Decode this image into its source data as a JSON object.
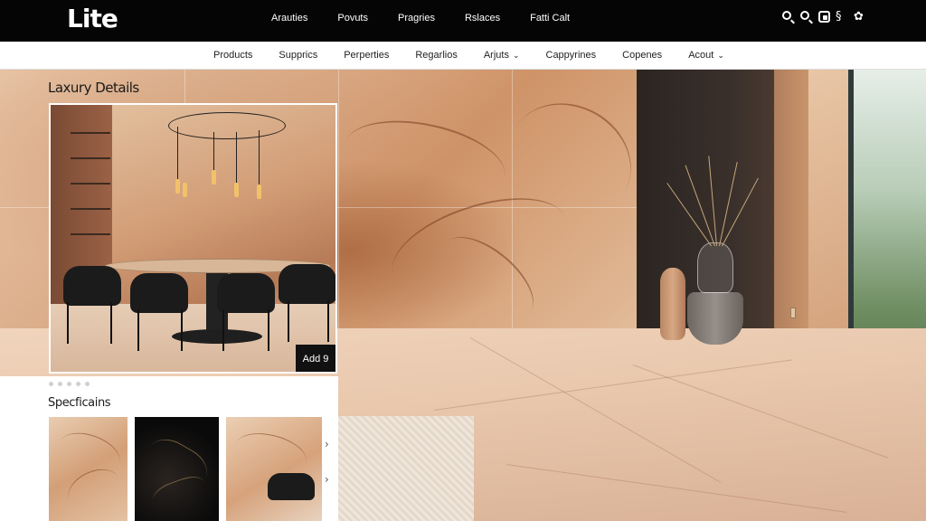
{
  "brand": {
    "logo": "Lite"
  },
  "top_nav": [
    "Arauties",
    "Povuts",
    "Pragries",
    "Rslaces",
    "Fatti Calt"
  ],
  "top_icons": [
    "search-icon",
    "search-icon",
    "share-icon",
    "wishlist-icon",
    "cart-icon"
  ],
  "sub_nav": [
    {
      "label": "Products"
    },
    {
      "label": "Supprics"
    },
    {
      "label": "Perperties"
    },
    {
      "label": "Regarlios"
    },
    {
      "label": "Arjuts",
      "dropdown": true
    },
    {
      "label": "Cappyrines"
    },
    {
      "label": "Copenes"
    },
    {
      "label": "Acout",
      "dropdown": true
    }
  ],
  "product": {
    "title": "Laxury Details",
    "badge": "Add 9",
    "dots_count": 5,
    "specifications_title": "Specficains"
  },
  "thumbnails": [
    {
      "name": "beige-marble-thumb"
    },
    {
      "name": "black-marble-thumb"
    },
    {
      "name": "room-marble-thumb"
    }
  ],
  "chevron": "›",
  "dropdown_caret": "⌄"
}
